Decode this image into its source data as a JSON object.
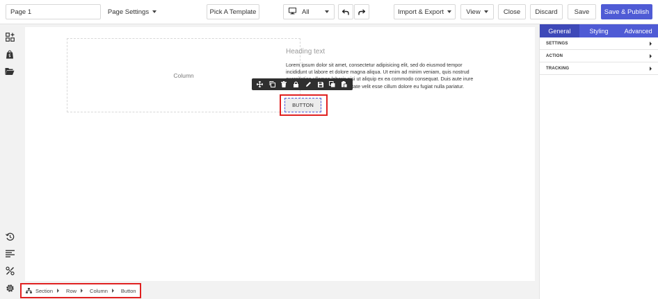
{
  "topbar": {
    "page_name": "Page 1",
    "page_settings": "Page Settings",
    "pick_template": "Pick A Template",
    "device": "All",
    "import_export": "Import & Export",
    "view": "View",
    "close": "Close",
    "discard": "Discard",
    "save": "Save",
    "publish": "Save & Publish"
  },
  "canvas": {
    "column_label": "Column",
    "heading": "Heading text",
    "lorem": "Lorem ipsum dolor sit amet, consectetur adipisicing elit, sed do eiusmod tempor incididunt ut labore et dolore magna aliqua. Ut enim ad minim veniam, quis nostrud exercitation ullamco laboris nisi ut aliquip ex ea commodo consequat. Duis aute irure dolor in reprehenderit in voluptate velit esse cillum dolore eu fugiat nulla pariatur.",
    "button_label": "BUTTON"
  },
  "breadcrumb": {
    "section": "Section",
    "row": "Row",
    "column": "Column",
    "button": "Button"
  },
  "panel": {
    "tabs": [
      "General",
      "Styling",
      "Advanced"
    ],
    "sections": [
      "SETTINGS",
      "ACTION",
      "TRACKING"
    ]
  },
  "colors": {
    "accent": "#4f5bd5",
    "highlight": "#e02020"
  }
}
